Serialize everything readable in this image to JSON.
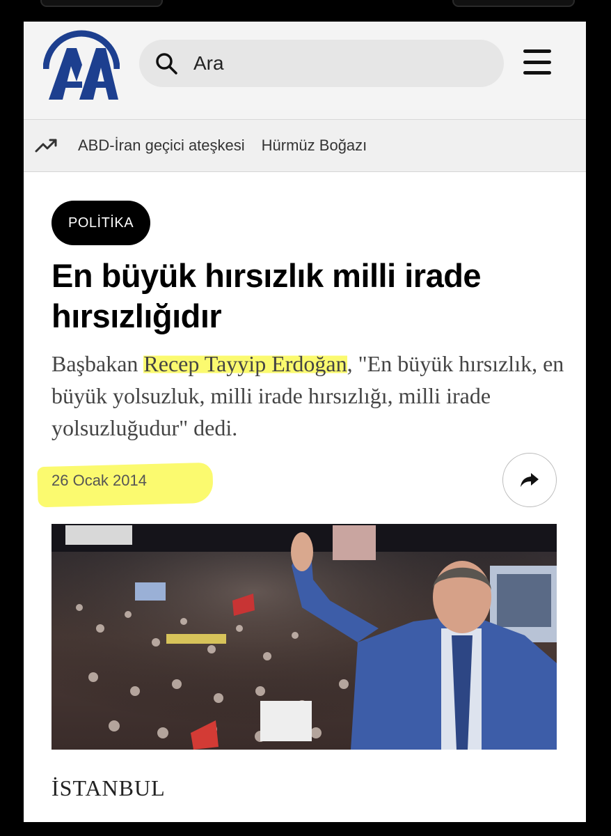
{
  "header": {
    "logo_text": "AA",
    "search_placeholder": "Ara",
    "menu_icon": "hamburger-menu-icon"
  },
  "trending": {
    "icon": "trending-up-icon",
    "topics": [
      "ABD-İran geçici ateşkesi",
      "Hürmüz Boğazı"
    ]
  },
  "article": {
    "category": "POLİTİKA",
    "headline": "En büyük hırsızlık milli irade hırsızlığıdır",
    "summary_before": "Başbakan ",
    "summary_highlight": "Recep Tayyip Erdoğan",
    "summary_after": ", \"En büyük hırsızlık, en büyük yolsuzluk, milli irade hırsızlığı, milli irade yolsuzluğudur\" dedi.",
    "date": "26 Ocak 2014",
    "share_icon": "share-icon",
    "dateline": "İSTANBUL"
  },
  "colors": {
    "brand_blue": "#1d3f8f",
    "highlight": "#fbfa6f",
    "category_bg": "#000000"
  }
}
